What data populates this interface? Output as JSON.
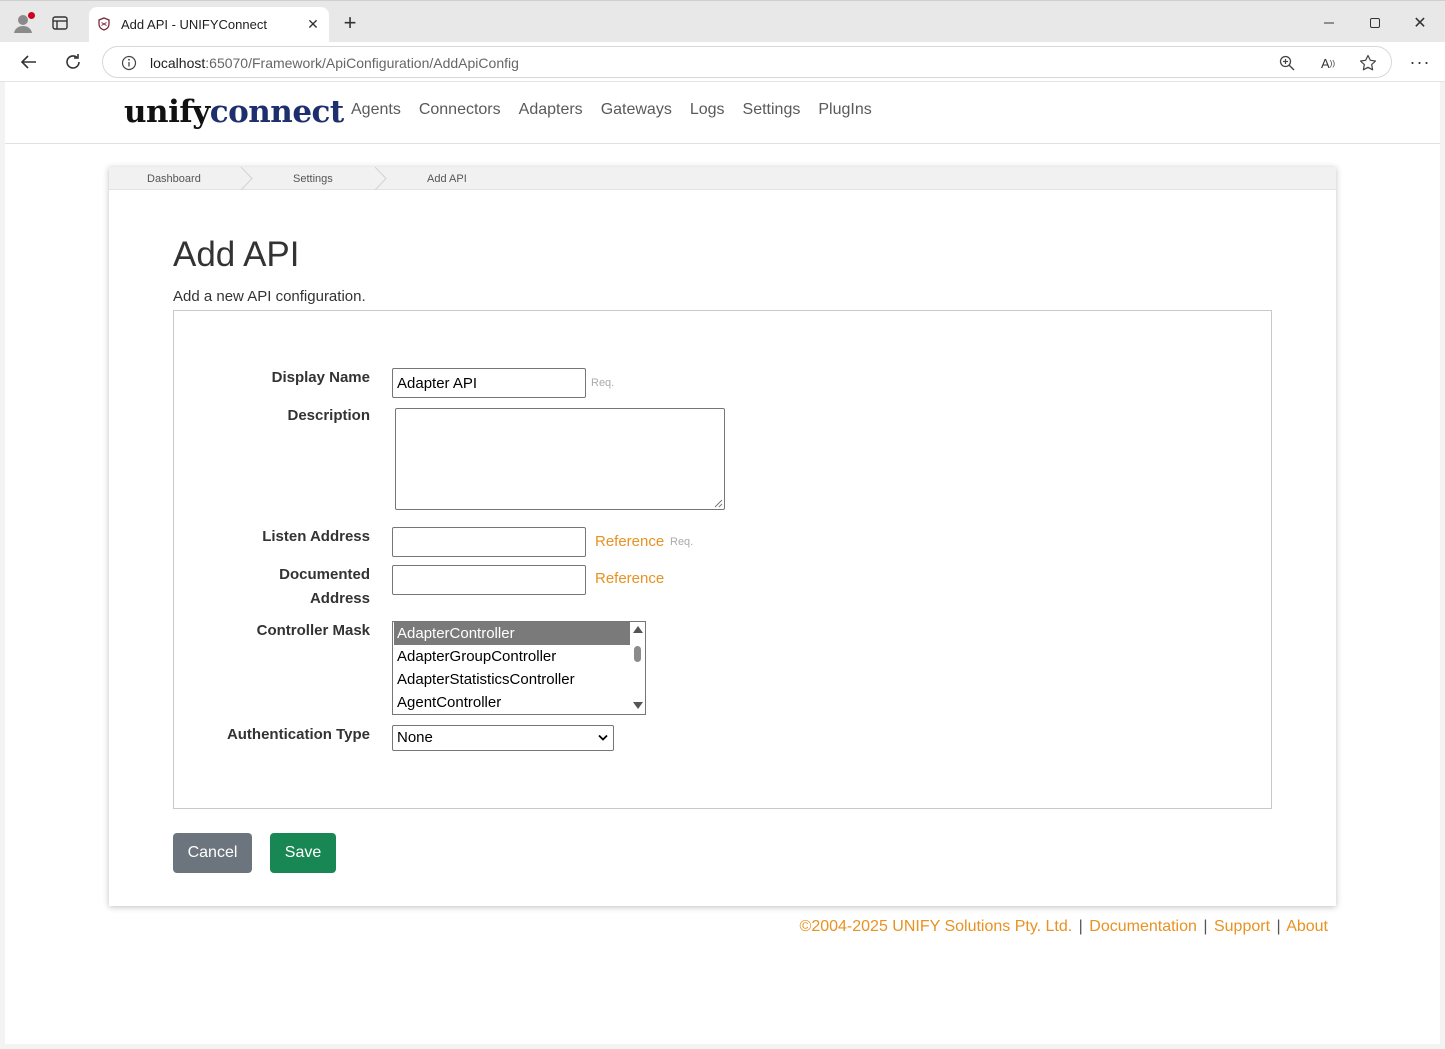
{
  "browser": {
    "tab_title": "Add API - UNIFYConnect",
    "url_host": "localhost",
    "url_rest": ":65070/Framework/ApiConfiguration/AddApiConfig",
    "icons": [
      "profile-icon",
      "tabs-icon",
      "close-icon",
      "plus-icon",
      "minimize-icon",
      "maximize-icon",
      "close-icon",
      "back-icon",
      "reload-icon",
      "info-icon",
      "zoom-icon",
      "read-aloud-icon",
      "favorite-icon",
      "more-icon"
    ]
  },
  "brand": {
    "logo_part1": "unify",
    "logo_part2": "connect",
    "logo_dark": "#111111",
    "logo_blue": "#1e2f6e"
  },
  "nav": {
    "items": [
      "Agents",
      "Connectors",
      "Adapters",
      "Gateways",
      "Logs",
      "Settings",
      "PlugIns"
    ]
  },
  "breadcrumb": {
    "items": [
      "Dashboard",
      "Settings",
      "Add API"
    ]
  },
  "page": {
    "title": "Add API",
    "subtitle": "Add a new API configuration."
  },
  "form": {
    "display_name": {
      "label": "Display Name",
      "value": "Adapter API",
      "hint": "Req."
    },
    "description": {
      "label": "Description",
      "value": ""
    },
    "listen_address": {
      "label": "Listen Address",
      "value": "",
      "reference": "Reference",
      "hint": "Req."
    },
    "documented_address": {
      "label_line1": "Documented",
      "label_line2": "Address",
      "value": "",
      "reference": "Reference"
    },
    "controller_mask": {
      "label": "Controller Mask",
      "options": [
        "AdapterController",
        "AdapterGroupController",
        "AdapterStatisticsController",
        "AgentController"
      ],
      "selected": "AdapterController"
    },
    "authentication_type": {
      "label": "Authentication Type",
      "value": "None"
    }
  },
  "actions": {
    "cancel": "Cancel",
    "save": "Save"
  },
  "colors": {
    "accent_orange": "#e89221",
    "save_green": "#198754",
    "cancel_gray": "#6c757d"
  },
  "footer": {
    "copyright": "©2004-2025 UNIFY Solutions Pty. Ltd.",
    "links": [
      "Documentation",
      "Support",
      "About"
    ]
  }
}
